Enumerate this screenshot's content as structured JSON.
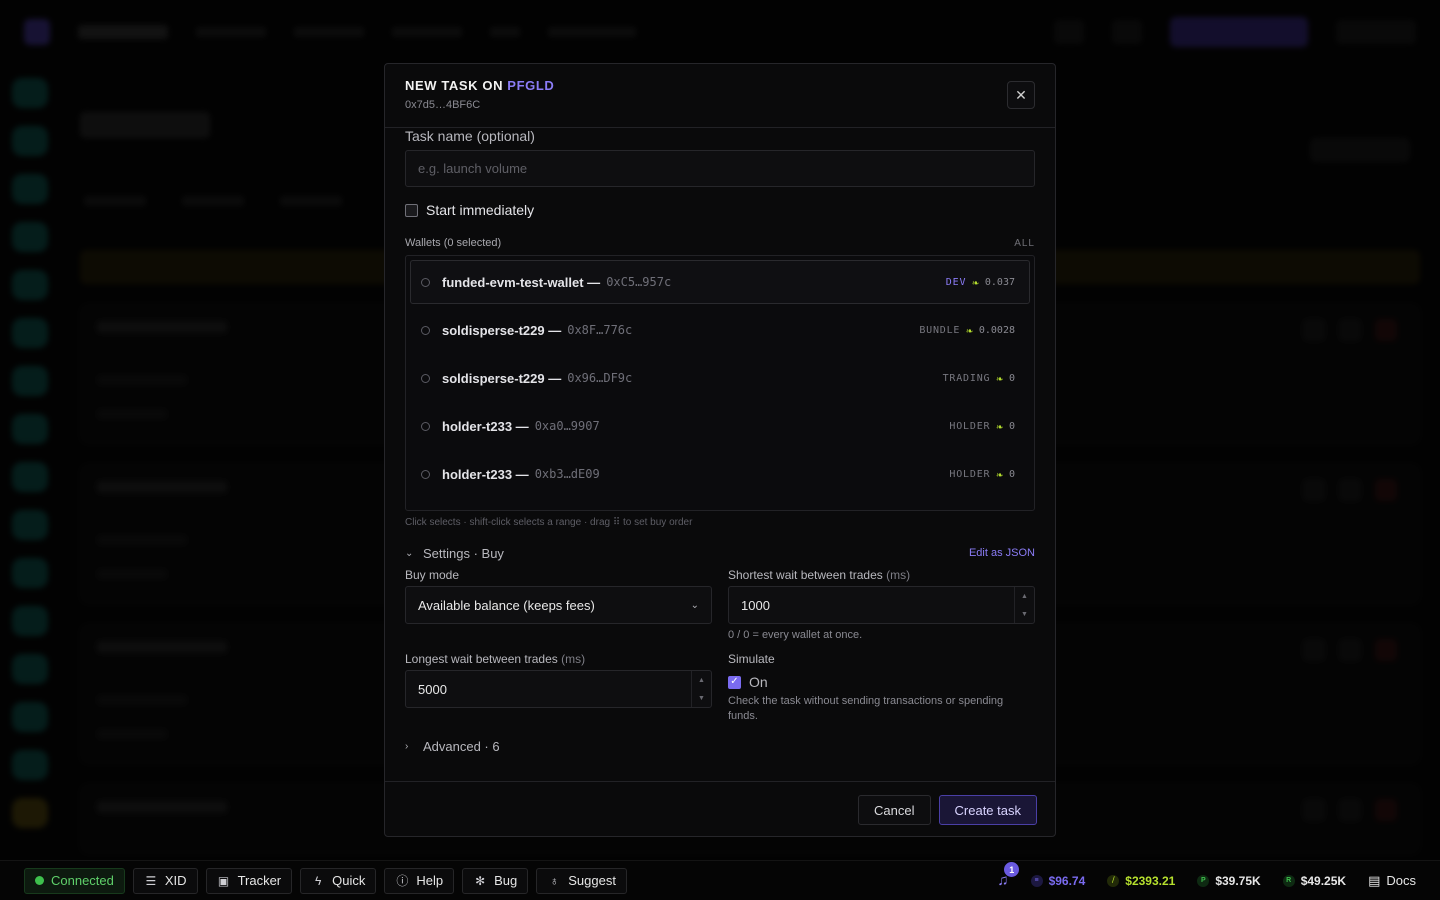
{
  "modal": {
    "title_prefix": "NEW TASK ON",
    "title_token": "PFGLD",
    "subtitle": "0x7d5…4BF6C",
    "close_symbol": "✕"
  },
  "task_name": {
    "label": "Task name (optional)",
    "placeholder": "e.g. launch volume",
    "value": ""
  },
  "start_immediately": {
    "label": "Start immediately",
    "checked": false
  },
  "wallets": {
    "label": "Wallets (0 selected)",
    "all_label": "ALL",
    "items": [
      {
        "name": "funded-evm-test-wallet —",
        "address": "0xC5…957c",
        "tag": "DEV",
        "balance": "0.037"
      },
      {
        "name": "soldisperse-t229 —",
        "address": "0x8F…776c",
        "tag": "BUNDLE",
        "balance": "0.0028"
      },
      {
        "name": "soldisperse-t229 —",
        "address": "0x96…DF9c",
        "tag": "TRADING",
        "balance": "0"
      },
      {
        "name": "holder-t233 —",
        "address": "0xa0…9907",
        "tag": "HOLDER",
        "balance": "0"
      },
      {
        "name": "holder-t233 —",
        "address": "0xb3…dE09",
        "tag": "HOLDER",
        "balance": "0"
      }
    ],
    "hint": "Click selects · shift-click selects a range · drag ⠿ to set buy order"
  },
  "settings": {
    "title": "Settings · Buy",
    "edit_json": "Edit as JSON",
    "buy_mode": {
      "label": "Buy mode",
      "value": "Available balance (keeps fees)"
    },
    "shortest_wait": {
      "label": "Shortest wait between trades",
      "unit": "(ms)",
      "value": "1000",
      "hint": "0 / 0 = every wallet at once."
    },
    "longest_wait": {
      "label": "Longest wait between trades",
      "unit": "(ms)",
      "value": "5000"
    },
    "simulate": {
      "label": "Simulate",
      "toggle_label": "On",
      "checked": true,
      "description": "Check the task without sending transactions or spending funds."
    }
  },
  "advanced": {
    "label": "Advanced · 6"
  },
  "footer": {
    "cancel": "Cancel",
    "create": "Create task"
  },
  "statusbar": {
    "connected": "Connected",
    "chips": [
      "XID",
      "Tracker",
      "Quick",
      "Help",
      "Bug",
      "Suggest"
    ],
    "notification_count": "1",
    "prices": [
      {
        "value": "$96.74",
        "color": "#7a6bf0",
        "symbol": "≡"
      },
      {
        "value": "$2393.21",
        "color": "#b6e02e",
        "symbol": "⧸"
      },
      {
        "value": "$39.75K",
        "color": "#3ec04d",
        "symbol": "P"
      },
      {
        "value": "$49.25K",
        "color": "#3ec04d",
        "symbol": "R"
      }
    ],
    "docs": "Docs"
  },
  "colors": {
    "accent": "#8b7cf6",
    "success": "#3ec04d",
    "lime": "#b6e02e"
  }
}
